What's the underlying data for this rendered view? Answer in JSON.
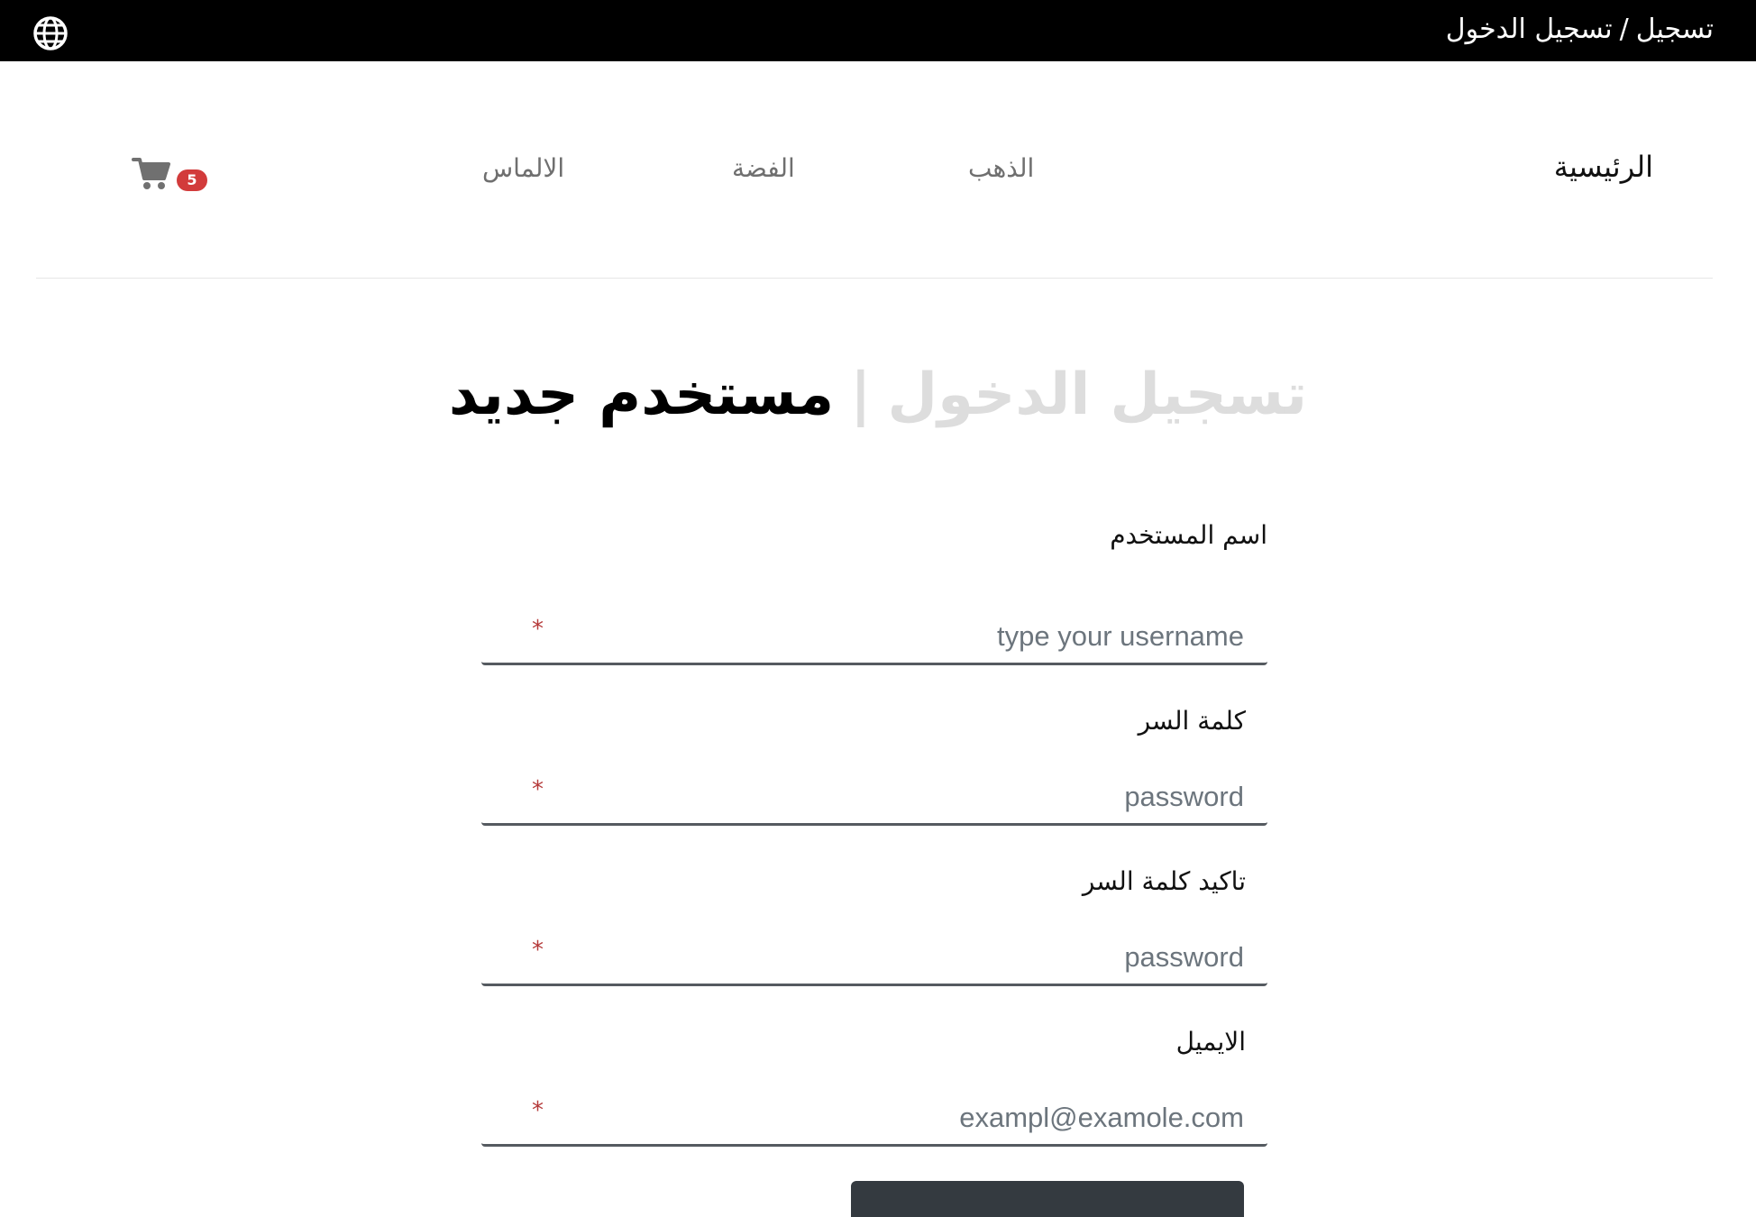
{
  "topbar": {
    "breadcrumb": {
      "register": "تسجيل",
      "separator": "/",
      "login": "تسجيل الدخول"
    },
    "language_icon": "globe-icon"
  },
  "nav": {
    "home": "الرئيسية",
    "gold": "الذهب",
    "silver": "الفضة",
    "diamond": "الالماس",
    "cart_icon": "cart-icon",
    "cart_count": "5",
    "cart_badge_color": "#d23b3b"
  },
  "title": {
    "login_tab": "تسجيل الدخول",
    "separator": "|",
    "register_tab": "مستخدم جديد"
  },
  "form": {
    "username": {
      "label": "اسم المستخدم",
      "placeholder": "type your username",
      "value": ""
    },
    "password": {
      "label": "كلمة السر",
      "placeholder": "password",
      "value": ""
    },
    "confirm_password": {
      "label": "تاكيد كلمة السر",
      "placeholder": "password",
      "value": ""
    },
    "email": {
      "label": "الايميل",
      "placeholder": "exampl@examole.com",
      "value": ""
    },
    "required_mark": "*"
  },
  "colors": {
    "topbar_bg": "#000000",
    "required": "#b53a3a",
    "button": "#343a40"
  }
}
